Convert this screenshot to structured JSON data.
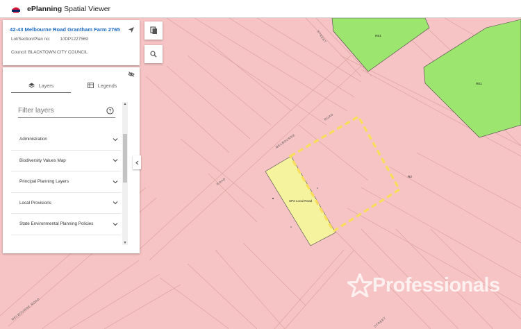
{
  "header": {
    "app_name_bold": "ePlanning",
    "app_name_rest": " Spatial Viewer"
  },
  "property": {
    "address": "42-43 Melbourne Road Grantham Farm 2765",
    "lot_label": "Lot/Section/Plan no:",
    "lot_value": "1//DP1227569",
    "council": "Council: BLACKTOWN CITY COUNCIL"
  },
  "tabs": {
    "layers": "Layers",
    "legends": "Legends"
  },
  "filter": {
    "placeholder": "Filter layers"
  },
  "layers": [
    {
      "label": "Administration"
    },
    {
      "label": "Biodiversity Values Map"
    },
    {
      "label": "Principal Planning Layers"
    },
    {
      "label": "Local Provisions"
    },
    {
      "label": "State Environmental Planning Policies"
    }
  ],
  "map": {
    "zone_labels": {
      "re1_a": "RE1",
      "re1_b": "RE1",
      "r2": "R2",
      "sp2": "SP2 Local Road"
    },
    "road_labels": {
      "melbourne_road_1": "MELBOURNE",
      "melbourne_road_2": "ROAD",
      "melbourne_road_3": "ROAD",
      "melbourne_road_4": "MELBOURNE ROAD",
      "street_top": "STREET",
      "street_bottom": "STREET"
    },
    "colors": {
      "r2": "#f6c4c4",
      "re1": "#9ce56f",
      "sp2": "#f5f39e",
      "highlight": "#f7df5a"
    }
  },
  "watermark": {
    "text": "Professionals"
  }
}
